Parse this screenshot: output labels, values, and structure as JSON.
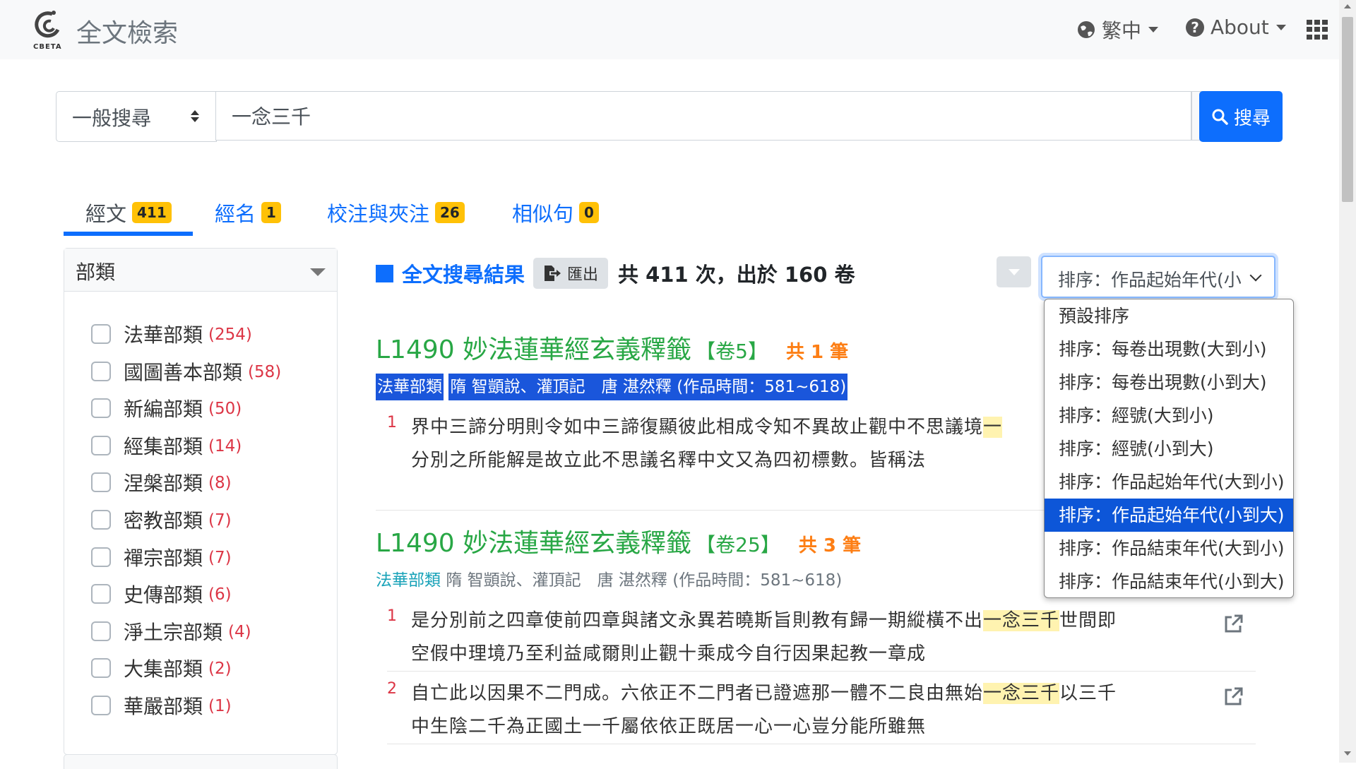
{
  "nav": {
    "brand_logo_text": "CBETA",
    "title": "全文檢索",
    "lang_label": "繁中",
    "about_label": "About"
  },
  "search": {
    "mode_label": "一般搜尋",
    "query": "一念三千",
    "search_button": "搜尋"
  },
  "tabs": [
    {
      "label": "經文",
      "count": "411"
    },
    {
      "label": "經名",
      "count": "1"
    },
    {
      "label": "校注與夾注",
      "count": "26"
    },
    {
      "label": "相似句",
      "count": "0"
    }
  ],
  "facet": {
    "title": "部類",
    "items": [
      {
        "label": "法華部類",
        "count": "(254)"
      },
      {
        "label": "國圖善本部類",
        "count": "(58)"
      },
      {
        "label": "新編部類",
        "count": "(50)"
      },
      {
        "label": "經集部類",
        "count": "(14)"
      },
      {
        "label": "涅槃部類",
        "count": "(8)"
      },
      {
        "label": "密教部類",
        "count": "(7)"
      },
      {
        "label": "禪宗部類",
        "count": "(7)"
      },
      {
        "label": "史傳部類",
        "count": "(6)"
      },
      {
        "label": "淨土宗部類",
        "count": "(4)"
      },
      {
        "label": "大集部類",
        "count": "(2)"
      },
      {
        "label": "華嚴部類",
        "count": "(1)"
      }
    ]
  },
  "results": {
    "title": "全文搜尋結果",
    "export_label": "匯出",
    "summary": "共 411 次，出於 160 卷",
    "sort_label": "排序：作品起始年代(小到大)",
    "sort_options": [
      "預設排序",
      "排序：每卷出現數(大到小)",
      "排序：每卷出現數(小到大)",
      "排序：經號(大到小)",
      "排序：經號(小到大)",
      "排序：作品起始年代(大到小)",
      "排序：作品起始年代(小到大)",
      "排序：作品結束年代(大到小)",
      "排序：作品結束年代(小到大)"
    ],
    "selected_sort_index": 6,
    "items": [
      {
        "title": "L1490 妙法蓮華經玄義釋籤",
        "juan": "【卷5】",
        "total": "共 1 筆",
        "category": "法華部類",
        "meta": "隋 智顗說、灌頂記　唐 湛然釋 (作品時間：581~618)",
        "hits": [
          {
            "num": "1",
            "before": "界中三諦分明則令如中三諦復顯彼此相成令知不異故止觀中不思議境",
            "kw": "一",
            "after": "",
            "line2": "分別之所能解是故立此不思議名釋中文又為四初標數。皆稱法"
          }
        ]
      },
      {
        "title": "L1490 妙法蓮華經玄義釋籤",
        "juan": "【卷25】",
        "total": "共 3 筆",
        "category": "法華部類",
        "meta": "隋 智顗說、灌頂記　唐 湛然釋 (作品時間：581~618)",
        "hits": [
          {
            "num": "1",
            "before": "是分別前之四章使前四章與諸文永異若曉斯旨則教有歸一期縱橫不出",
            "kw": "一念三千",
            "after": "世間即",
            "line2": "空假中理境乃至利益咸爾則止觀十乘成今自行因果起教一章成"
          },
          {
            "num": "2",
            "before": "自亡此以因果不二門成。六依正不二門者已證遮那一體不二良由無始",
            "kw": "一念三千",
            "after": "以三千",
            "line2": "中生陰二千為正國土一千屬依依正既居一心一心豈分能所雖無"
          }
        ]
      }
    ]
  },
  "colors": {
    "primary": "#0d6efd",
    "badge": "#ffc107",
    "title_green": "#28a745",
    "count_red": "#dc3545",
    "total_orange": "#fd7e14",
    "keyword_highlight": "#fff3b0"
  },
  "icons": [
    "cbeta-logo-icon",
    "globe-icon",
    "question-circle-icon",
    "apps-grid-icon",
    "gear-icon",
    "search-icon",
    "export-icon",
    "external-link-icon"
  ]
}
